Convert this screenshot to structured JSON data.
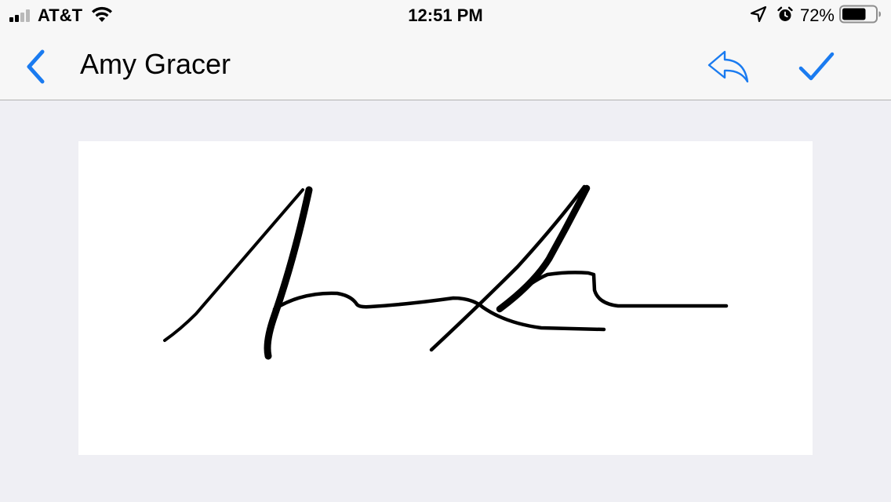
{
  "status_bar": {
    "carrier": "AT&T",
    "time": "12:51 PM",
    "battery_percent": "72%",
    "signal_bars_filled": 2,
    "signal_bars_total": 4,
    "battery_level": 0.72,
    "icons": [
      "signal-bars-icon",
      "wifi-icon",
      "location-arrow-icon",
      "alarm-clock-icon",
      "battery-icon"
    ]
  },
  "nav_bar": {
    "title": "Amy Gracer",
    "back_icon": "chevron-left-icon",
    "undo_icon": "undo-arrow-icon",
    "done_icon": "checkmark-icon"
  },
  "colors": {
    "accent": "#1a7bf0",
    "ink": "#000000",
    "background": "#efeff4",
    "bar": "#f7f7f7",
    "pad": "#ffffff"
  }
}
